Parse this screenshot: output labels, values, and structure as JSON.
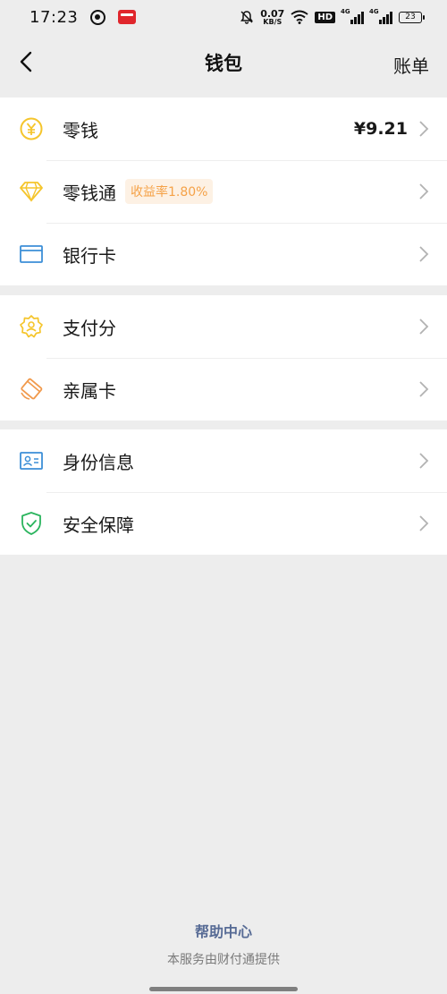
{
  "status_bar": {
    "time": "17:23",
    "net_speed_value": "0.07",
    "net_speed_unit": "KB/S",
    "hd_label": "HD",
    "signal1_label": "4G",
    "signal2_label": "4G",
    "battery": "23"
  },
  "nav": {
    "title": "钱包",
    "right_action": "账单",
    "back_icon": "chevron-left-icon"
  },
  "groups": [
    {
      "items": [
        {
          "label": "零钱",
          "value": "¥9.21",
          "icon": "yuan-coin-icon",
          "color": "#f5c52c"
        },
        {
          "label": "零钱通",
          "badge": "收益率1.80%",
          "icon": "diamond-icon",
          "color": "#f5c52c"
        },
        {
          "label": "银行卡",
          "icon": "bank-card-icon",
          "color": "#3c8fd7"
        }
      ]
    },
    {
      "items": [
        {
          "label": "支付分",
          "icon": "payment-score-icon",
          "color": "#f5c52c"
        },
        {
          "label": "亲属卡",
          "icon": "family-card-icon",
          "color": "#f19a4c"
        }
      ]
    },
    {
      "items": [
        {
          "label": "身份信息",
          "icon": "id-card-icon",
          "color": "#3c8fd7"
        },
        {
          "label": "安全保障",
          "icon": "shield-check-icon",
          "color": "#2ab45d"
        }
      ]
    }
  ],
  "footer": {
    "help_link": "帮助中心",
    "provider_text": "本服务由财付通提供"
  }
}
